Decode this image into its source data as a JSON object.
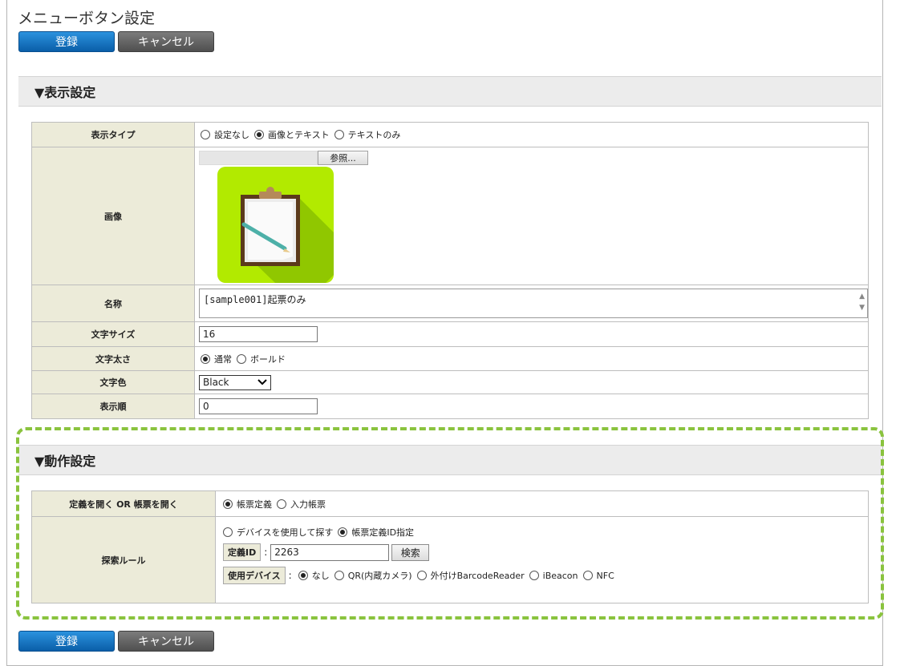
{
  "page": {
    "title": "メニューボタン設定"
  },
  "buttons": {
    "register": "登録",
    "cancel": "キャンセル"
  },
  "display_section": {
    "heading": "▼表示設定",
    "display_type": {
      "label": "表示タイプ",
      "options": [
        "設定なし",
        "画像とテキスト",
        "テキストのみ"
      ],
      "selected": 1
    },
    "image": {
      "label": "画像",
      "browse_label": "参照..."
    },
    "name": {
      "label": "名称",
      "value_code": "[sample001]",
      "value_text": "起票のみ"
    },
    "font_size": {
      "label": "文字サイズ",
      "value": "16"
    },
    "font_weight": {
      "label": "文字太さ",
      "options": [
        "通常",
        "ボールド"
      ],
      "selected": 0
    },
    "font_color": {
      "label": "文字色",
      "value": "Black"
    },
    "display_order": {
      "label": "表示順",
      "value": "0"
    }
  },
  "action_section": {
    "heading": "▼動作設定",
    "open_mode": {
      "label": "定義を開く OR 帳票を開く",
      "options": [
        "帳票定義",
        "入力帳票"
      ],
      "selected": 0
    },
    "search_rule": {
      "label": "探索ルール",
      "method_options": [
        "デバイスを使用して探す",
        "帳票定義ID指定"
      ],
      "method_selected": 1,
      "definition_id_label": "定義ID",
      "definition_id_value": "2263",
      "search_button": "検索",
      "device_label": "使用デバイス",
      "colon": ":",
      "device_options": [
        "なし",
        "QR(内蔵カメラ)",
        "外付けBarcodeReader",
        "iBeacon",
        "NFC"
      ],
      "device_selected": 0
    }
  },
  "colors": {
    "primary": "#0a6fc2",
    "cancel": "#5d5d5d",
    "label_bg": "#ecebd9",
    "highlight": "#8ac33e",
    "icon_bg": "#b2ea00"
  }
}
